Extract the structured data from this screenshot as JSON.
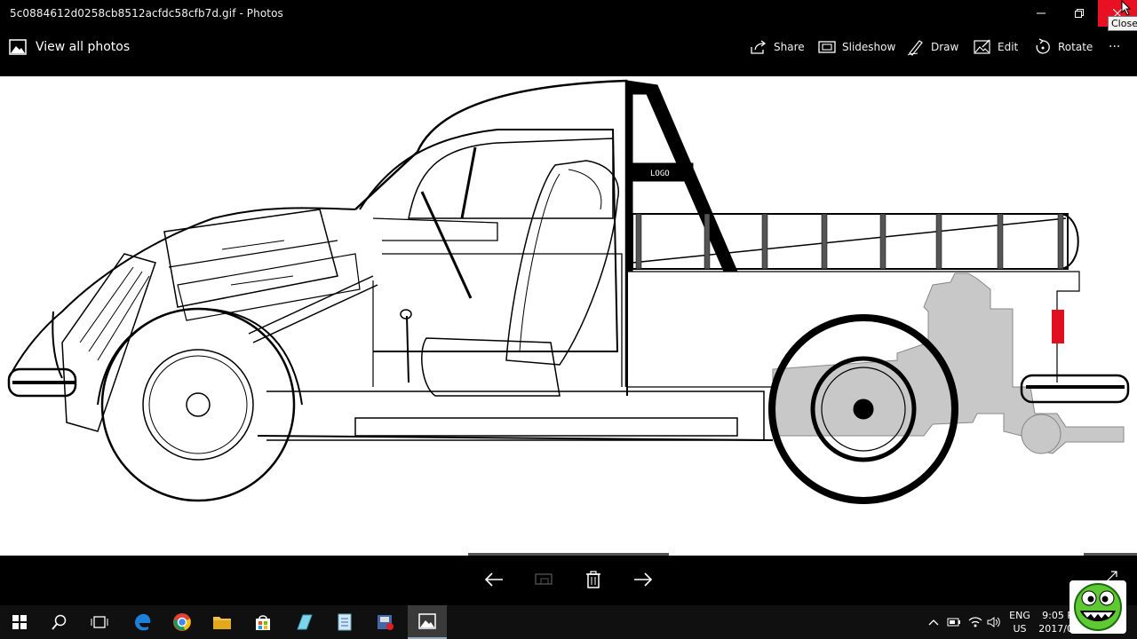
{
  "window": {
    "title": "5c0884612d0258cb8512acfdc58cfb7d.gif - Photos",
    "close_tooltip": "Close"
  },
  "toolbar": {
    "view_all": "View all photos",
    "share": "Share",
    "slideshow": "Slideshow",
    "draw": "Draw",
    "edit": "Edit",
    "rotate": "Rotate",
    "more": "···"
  },
  "photo": {
    "logo_text": "LOGO"
  },
  "taskbar": {
    "lang_top": "ENG",
    "lang_bottom": "US",
    "time": "9:05 P",
    "date": "2017/0"
  },
  "colors": {
    "close_red": "#e81123",
    "taillight_red": "#e01020",
    "engine_gray": "#c8c8c8"
  }
}
